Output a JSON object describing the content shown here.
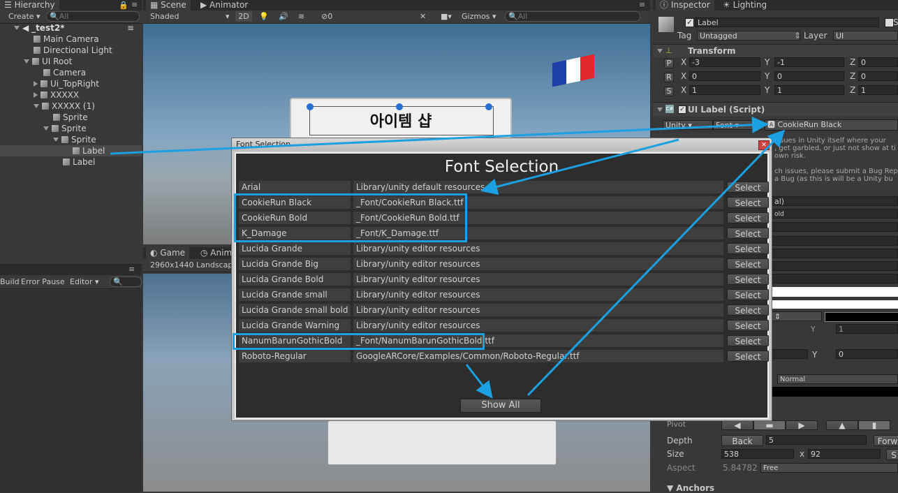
{
  "hierarchy": {
    "tab": "Hierarchy",
    "create": "Create",
    "search_placeholder": "All",
    "scene": "_test2*",
    "rows": [
      {
        "label": "Main Camera"
      },
      {
        "label": "Directional Light"
      },
      {
        "label": "UI Root"
      },
      {
        "label": "Camera"
      },
      {
        "label": "Ui_TopRight"
      },
      {
        "label": "XXXXX"
      },
      {
        "label": "XXXXX (1)"
      },
      {
        "label": "Sprite"
      },
      {
        "label": "Sprite"
      },
      {
        "label": "Sprite"
      },
      {
        "label": "Label"
      },
      {
        "label": "Label"
      }
    ]
  },
  "console": {
    "build": "Build",
    "error_pause": "Error Pause",
    "editor": "Editor"
  },
  "scene_view": {
    "tab_scene": "Scene",
    "tab_animator": "Animator",
    "shaded": "Shaded",
    "mode_2d": "2D",
    "hidden_count": "0",
    "gizmos": "Gizmos",
    "search_placeholder": "All",
    "panel_title": "아이템 샵"
  },
  "game_view": {
    "tab_game": "Game",
    "tab_anim": "Animi",
    "resolution": "2960x1440 Landscap"
  },
  "inspector": {
    "tab_inspector": "Inspector",
    "tab_lighting": "Lighting",
    "object_name": "Label",
    "static_initial": "S",
    "tag_label": "Tag",
    "tag_value": "Untagged",
    "layer_label": "Layer",
    "layer_value": "UI",
    "transform_title": "Transform",
    "position": {
      "x": "-3",
      "y": "-1",
      "z": "0"
    },
    "rotation": {
      "x": "0",
      "y": "0",
      "z": "0"
    },
    "scale": {
      "x": "1",
      "y": "1",
      "z": "1"
    },
    "p": "P",
    "r": "R",
    "s": "S",
    "x": "X",
    "y": "Y",
    "z": "Z",
    "ui_label_title": "UI Label (Script)",
    "font_type": "Unity",
    "font_label": "Font",
    "font_value": "CookieRun Black",
    "warning_lines": [
      "issues in Unity itself where your",
      ", get garbled, or just not show at ti",
      "own risk.",
      "",
      "ch issues, please submit a Bug Repo",
      "a Bug (as this is will be a Unity bu"
    ],
    "partial_l": "al)",
    "partial_bold": "old",
    "partial_y1": "1",
    "partial_y0": "0",
    "normal": "Normal",
    "pivot": "Pivot",
    "depth_label": "Depth",
    "depth_btn": "Back",
    "depth_value": "5",
    "forward": "Forw",
    "size_label": "Size",
    "size_w": "538",
    "size_x": "x",
    "size_h": "92",
    "size_s": "S",
    "aspect_label": "Aspect",
    "aspect_value": "5.84782",
    "aspect_mode": "Free",
    "anchors": "Anchors"
  },
  "dialog": {
    "window_title": "Font Selection",
    "heading": "Font Selection",
    "select_label": "Select",
    "show_all": "Show All",
    "fonts": [
      {
        "name": "Arial",
        "path": "Library/unity default resources"
      },
      {
        "name": "CookieRun Black",
        "path": "_Font/CookieRun Black.ttf"
      },
      {
        "name": "CookieRun Bold",
        "path": "_Font/CookieRun Bold.ttf"
      },
      {
        "name": "K_Damage",
        "path": "_Font/K_Damage.ttf"
      },
      {
        "name": "Lucida Grande",
        "path": "Library/unity editor resources"
      },
      {
        "name": "Lucida Grande Big",
        "path": "Library/unity editor resources"
      },
      {
        "name": "Lucida Grande Bold",
        "path": "Library/unity editor resources"
      },
      {
        "name": "Lucida Grande small",
        "path": "Library/unity editor resources"
      },
      {
        "name": "Lucida Grande small bold",
        "path": "Library/unity editor resources"
      },
      {
        "name": "Lucida Grande Warning",
        "path": "Library/unity editor resources"
      },
      {
        "name": "NanumBarunGothicBold",
        "path": "_Font/NanumBarunGothicBold.ttf"
      },
      {
        "name": "Roboto-Regular",
        "path": "GoogleARCore/Examples/Common/Roboto-Regular.ttf"
      }
    ]
  },
  "colors": {
    "highlight": "#1ba0e2",
    "panel": "#383838",
    "dark": "#2b2b2b"
  }
}
